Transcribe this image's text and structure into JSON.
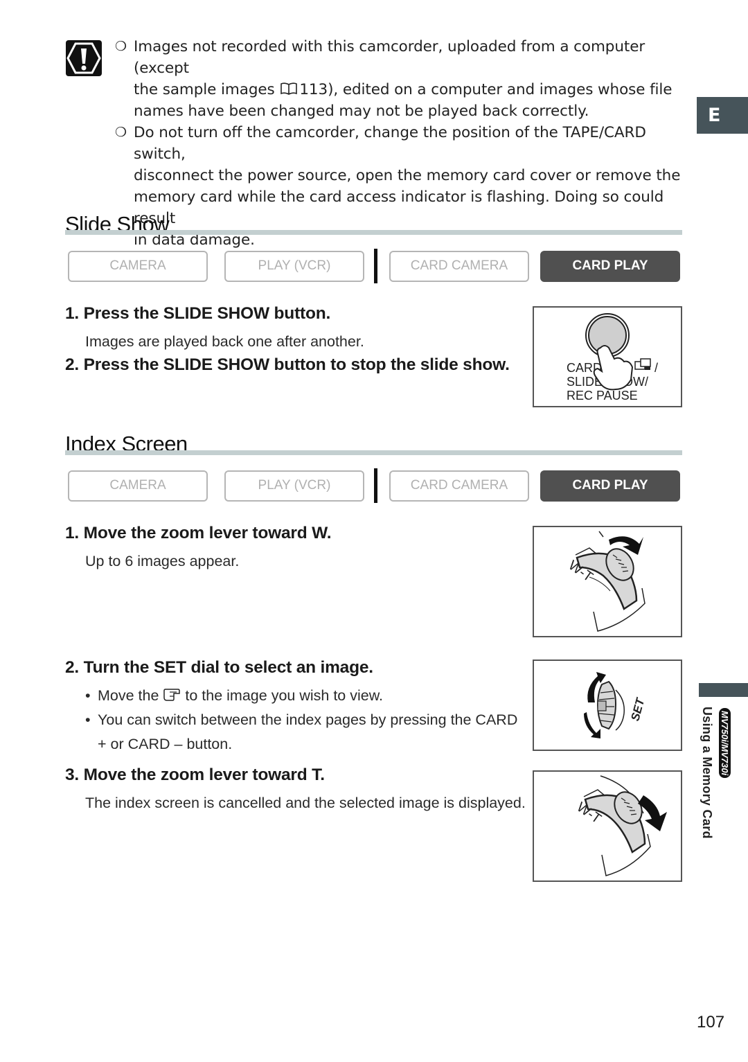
{
  "caution": {
    "icon": "caution-exclamation-icon",
    "items": [
      {
        "bullet": "❍",
        "line1": "Images not recorded with this camcorder, uploaded from a computer (except",
        "line2_before": "the sample images ",
        "line2_ref_icon": "book-reference-icon",
        "line2_ref_page": "113",
        "line2_after": "), edited on a computer and images whose file",
        "line3": "names have been changed may not be played back correctly."
      },
      {
        "bullet": "❍",
        "line1": "Do not turn off the camcorder, change the position of the TAPE/CARD switch,",
        "line2": "disconnect the power source, open the memory card cover or remove the",
        "line3": "memory card while the card access indicator is flashing. Doing so could result",
        "line4": "in data damage."
      }
    ]
  },
  "language_tab": "E",
  "modes": {
    "camera": "CAMERA",
    "play_vcr": "PLAY (VCR)",
    "card_camera": "CARD CAMERA",
    "card_play": "CARD PLAY",
    "active": "card_play",
    "active_color": "#505050",
    "inactive_color": "#b0b0b0"
  },
  "slide_show": {
    "title": "Slide Show",
    "steps": [
      {
        "head": "1. Press the SLIDE SHOW button.",
        "body": "Images are played back one after another."
      },
      {
        "head": "2. Press the SLIDE SHOW button to stop the slide show."
      }
    ],
    "figure": {
      "label_line1": "CARD",
      "label_line1_suffix": "/",
      "label_line2": "SLIDE SHOW/",
      "label_line3": "REC PAUSE"
    }
  },
  "index_screen": {
    "title": "Index Screen",
    "steps": [
      {
        "head": "1. Move the zoom lever toward W.",
        "body": "Up to 6 images appear."
      },
      {
        "head": "2. Turn the SET dial to select an image.",
        "bullets": [
          {
            "before": "Move the ",
            "icon": "pointer-hand-icon",
            "after": " to the image you wish to view."
          },
          {
            "line1": "You can switch between the index pages by pressing the CARD",
            "line2": "+ or CARD – button."
          }
        ]
      },
      {
        "head": "3. Move the zoom lever toward T.",
        "body": "The index screen is cancelled and the selected image is displayed."
      }
    ],
    "figures": {
      "zoom_w_label": "W-T",
      "set_dial_label": "SET",
      "zoom_t_label": "W-T"
    }
  },
  "side_tab": {
    "label": "Using a Memory Card",
    "badge": "MV750i/MV730i",
    "color": "#46545a"
  },
  "page_number": "107"
}
